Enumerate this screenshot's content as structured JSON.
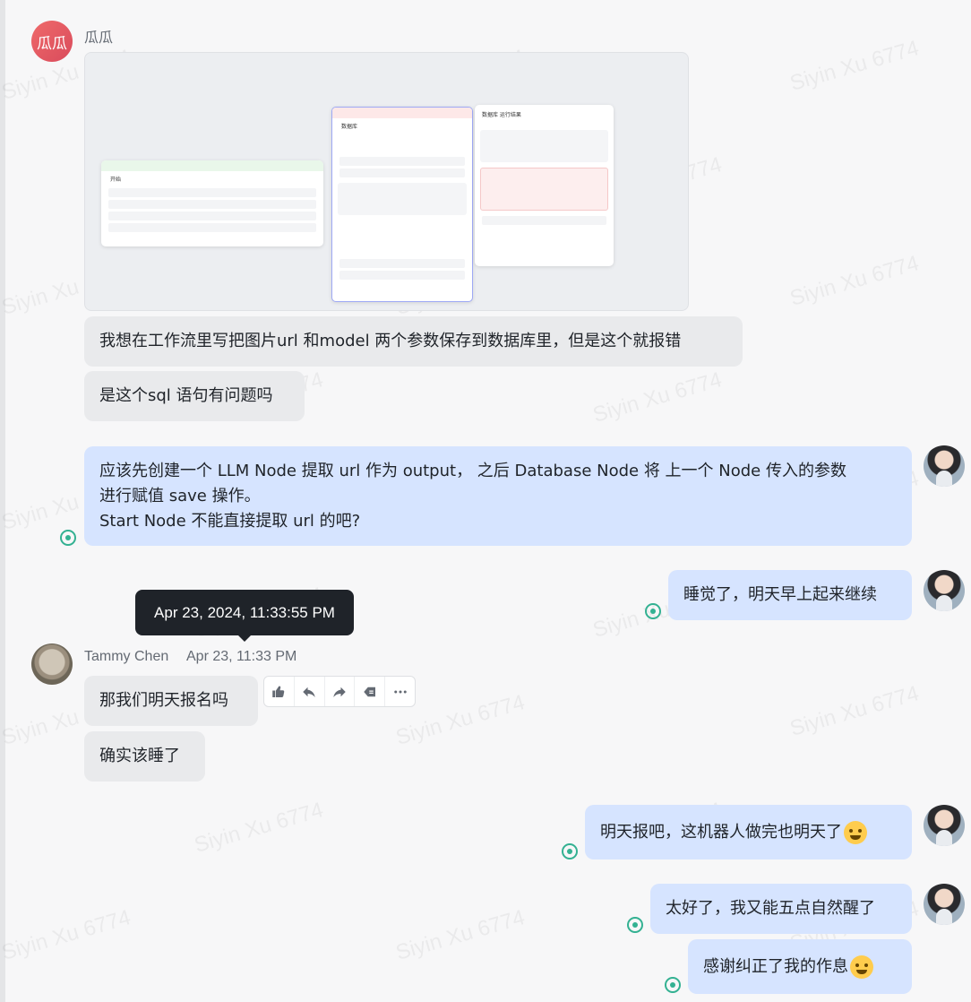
{
  "watermark": "Siyin Xu 6774",
  "messages": {
    "m1": {
      "sender": "瓜瓜",
      "avatar_text": "瓜瓜",
      "screenshot": {
        "node1_title": "开始",
        "node2_title": "数据库",
        "node3_title": "数据库 运行结果"
      },
      "texts": [
        "我想在工作流里写把图片url 和model 两个参数保存到数据库里，但是这个就报错",
        "是这个sql 语句有问题吗"
      ]
    },
    "m2": {
      "lines": [
        "应该先创建一个 LLM Node 提取 url 作为 output， 之后 Database Node 将 上一个 Node 传入的参数",
        "进行赋值 save 操作。",
        "Start Node 不能直接提取 url 的吧?"
      ]
    },
    "m3": {
      "text": "睡觉了，明天早上起来继续"
    },
    "m4": {
      "sender": "Tammy Chen",
      "time": "Apr 23, 11:33 PM",
      "tooltip": "Apr 23, 2024, 11:33:55 PM",
      "texts": [
        "那我们明天报名吗",
        "确实该睡了"
      ]
    },
    "m5": {
      "text": "明天报吧，这机器人做完也明天了"
    },
    "m6": {
      "texts": [
        "太好了，我又能五点自然醒了",
        "感谢纠正了我的作息"
      ]
    }
  },
  "hover_actions": [
    {
      "name": "thumbs-up-icon"
    },
    {
      "name": "reply-icon"
    },
    {
      "name": "forward-icon"
    },
    {
      "name": "pin-icon"
    },
    {
      "name": "more-icon"
    }
  ],
  "colors": {
    "bubble_grey": "#e9eaec",
    "bubble_blue": "#d6e4ff",
    "read_receipt": "#33b192",
    "tooltip_bg": "#1f2329"
  }
}
